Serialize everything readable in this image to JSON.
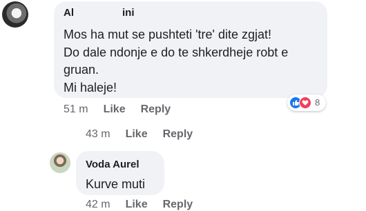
{
  "comment_1": {
    "author": "Aleksandra Marini",
    "author_visible_start": "Al",
    "author_visible_end": "ini",
    "text": "Mos ha mut se pushteti 'tre' dite zgjat!\nDo dale ndonje e do te shkerdheje robt e\ngruan.\nMi haleje!",
    "time": "51 m",
    "like_label": "Like",
    "reply_label": "Reply",
    "reaction_count": "8",
    "reactions": [
      "like-icon",
      "love-icon"
    ]
  },
  "reply_row": {
    "time": "43 m",
    "like_label": "Like",
    "reply_label": "Reply"
  },
  "comment_2": {
    "author": "Voda Aurel",
    "text": "Kurve muti",
    "time": "42 m",
    "like_label": "Like",
    "reply_label": "Reply"
  },
  "colors": {
    "bubble": "#f0f2f5",
    "meta_text": "#65676b",
    "like_blue": "#1877f2",
    "love_red": "#f33e58"
  }
}
